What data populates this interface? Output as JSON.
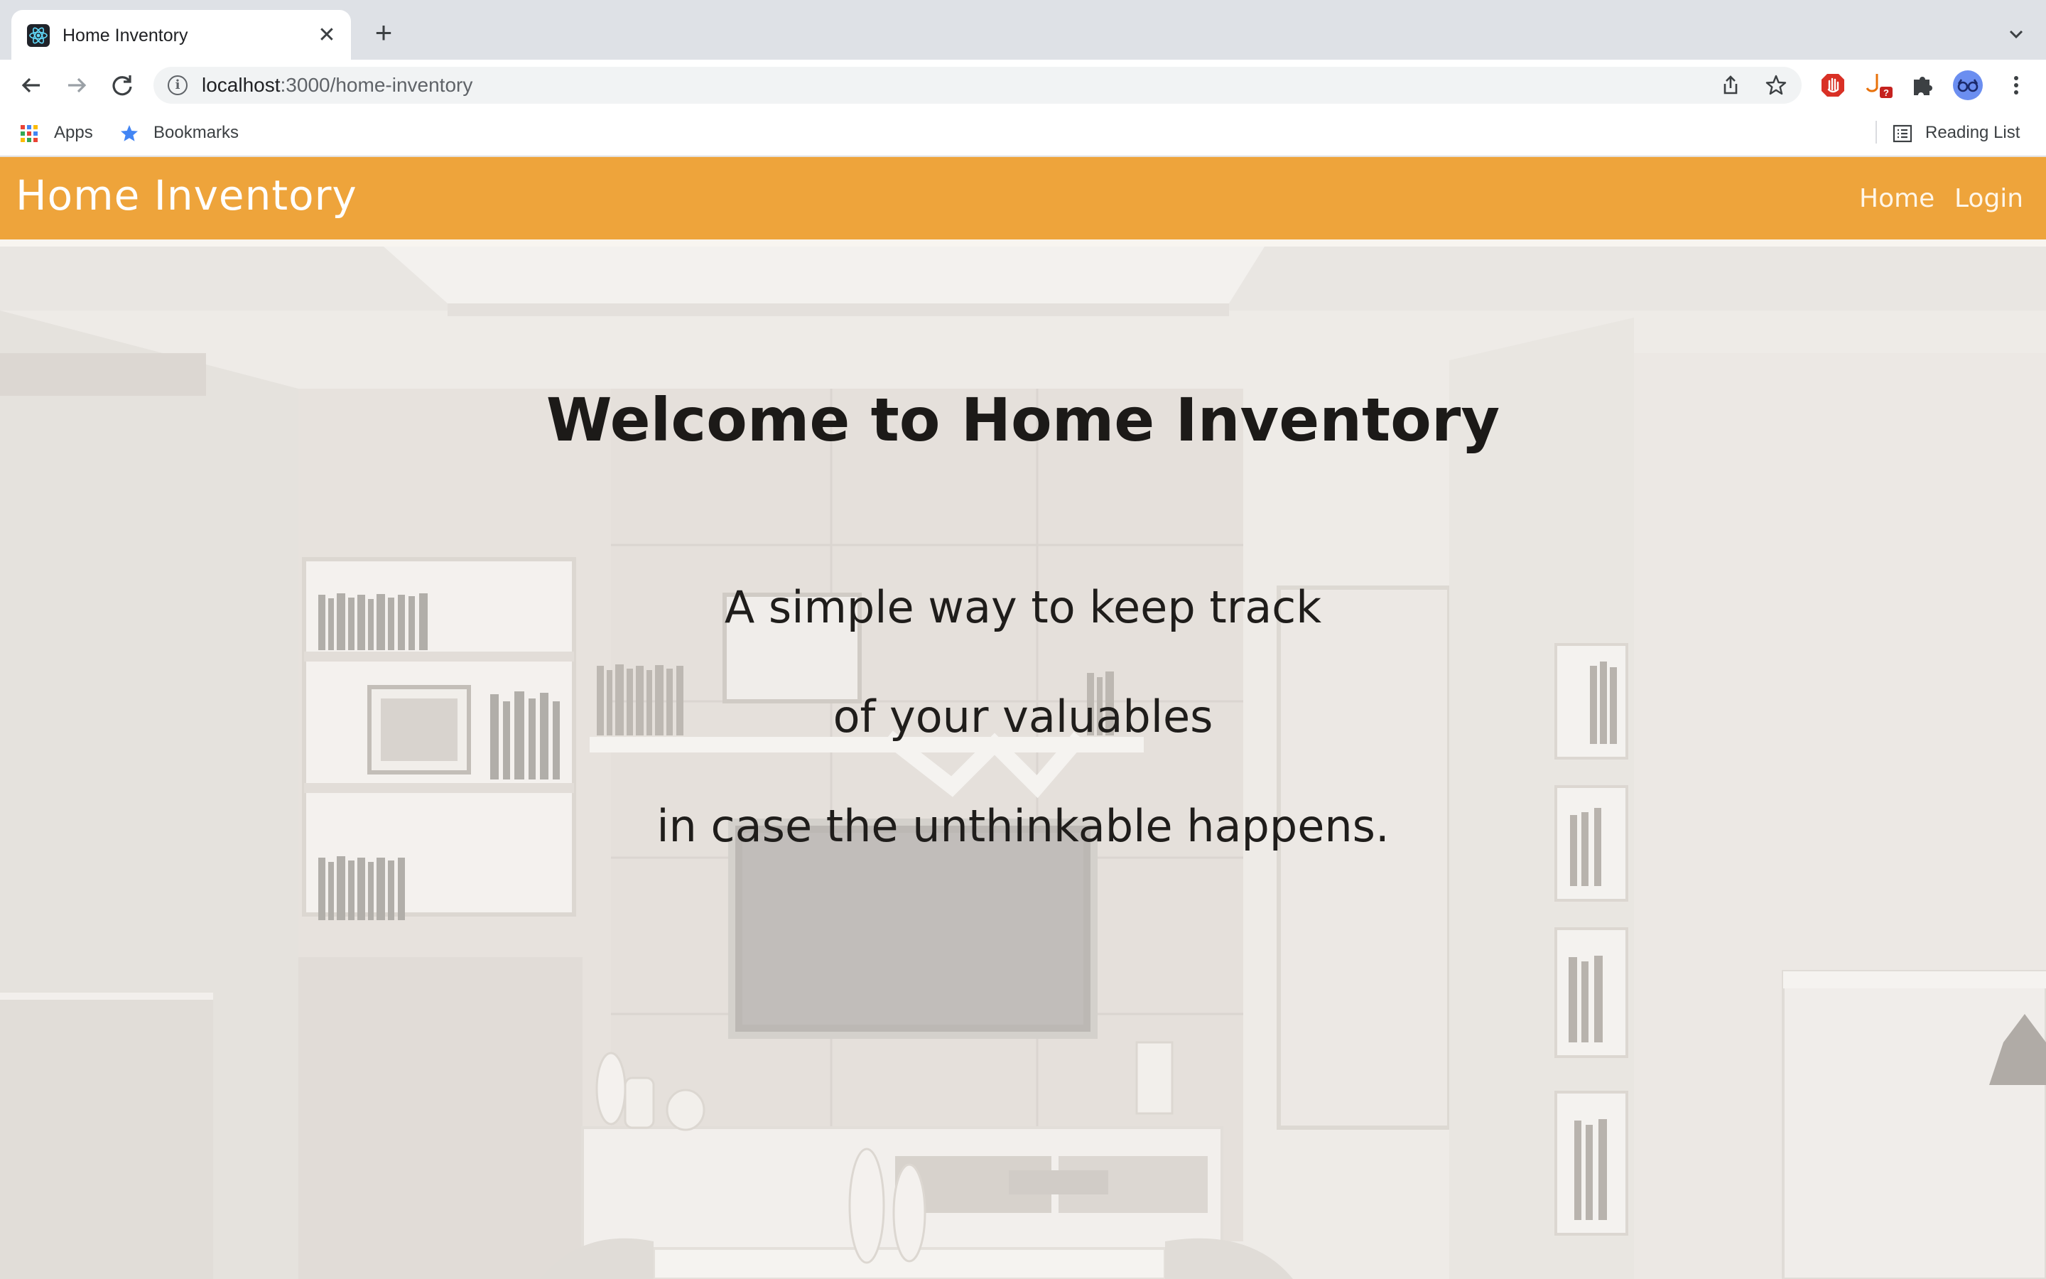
{
  "browser": {
    "tab_title": "Home Inventory",
    "url_host": "localhost",
    "url_rest": ":3000/home-inventory",
    "bookmarks": [
      {
        "label": "Apps",
        "icon": "apps-grid-icon"
      },
      {
        "label": "Bookmarks",
        "icon": "star-icon"
      }
    ],
    "reading_list_label": "Reading List"
  },
  "navbar": {
    "brand": "Home Inventory",
    "links": [
      "Home",
      "Login"
    ],
    "background_color": "#eea43b"
  },
  "hero": {
    "title": "Welcome to Home Inventory",
    "lines": [
      "A simple way to keep track",
      "of your valuables",
      "in case the unthinkable happens."
    ]
  }
}
